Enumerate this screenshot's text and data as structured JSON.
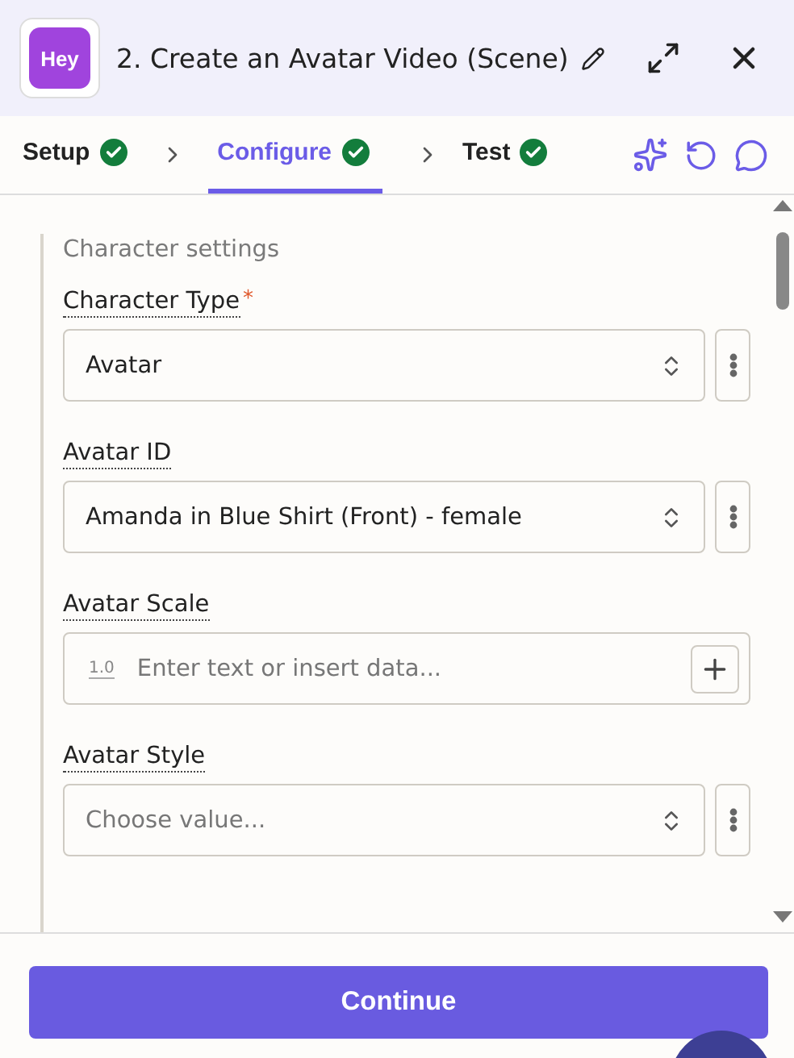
{
  "header": {
    "logo": "Hey",
    "title": "2. Create an Avatar Video (Scene)"
  },
  "steps": [
    {
      "label": "Setup",
      "selected": false,
      "done": true
    },
    {
      "label": "Configure",
      "selected": true,
      "done": true
    },
    {
      "label": "Test",
      "selected": false,
      "done": true
    }
  ],
  "section": {
    "title": "Character settings",
    "required_sign": "*"
  },
  "fields": [
    {
      "kind": "select",
      "label": "Character Type",
      "required": true,
      "value": "Avatar"
    },
    {
      "kind": "select",
      "label": "Avatar ID",
      "required": false,
      "value": "Amanda in Blue Shirt (Front) - female"
    },
    {
      "kind": "text",
      "label": "Avatar Scale",
      "required": false,
      "type_hint": "1.0",
      "placeholder": "Enter text or insert data..."
    },
    {
      "kind": "select",
      "label": "Avatar Style",
      "required": false,
      "placeholder": "Choose value..."
    }
  ],
  "footer": {
    "button": "Continue"
  }
}
